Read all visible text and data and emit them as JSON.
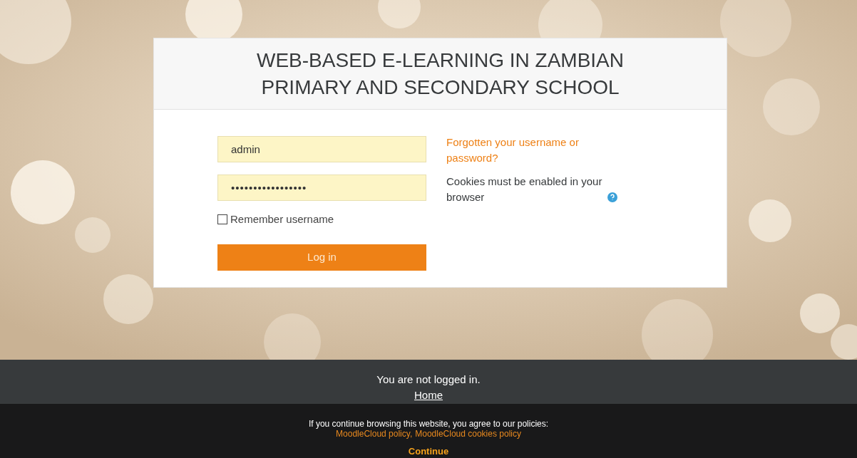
{
  "site_title": "WEB-BASED E-LEARNING IN ZAMBIAN PRIMARY AND SECONDARY SCHOOL",
  "login": {
    "username": "admin",
    "password": "•••••••••••••••••",
    "remember": {
      "label": "Remember username",
      "checked": false
    },
    "button": "Log in"
  },
  "help": {
    "forgot_link": "Forgotten your username or password?",
    "cookies_note": "Cookies must be enabled in your browser"
  },
  "footer": {
    "status": "You are not logged in.",
    "links": [
      "Home"
    ]
  },
  "cookie_banner": {
    "message": "If you continue browsing this website, you agree to our policies:",
    "policy_links": [
      "MoodleCloud policy",
      "MoodleCloud cookies policy"
    ],
    "link_separator": ",",
    "continue": "Continue"
  }
}
